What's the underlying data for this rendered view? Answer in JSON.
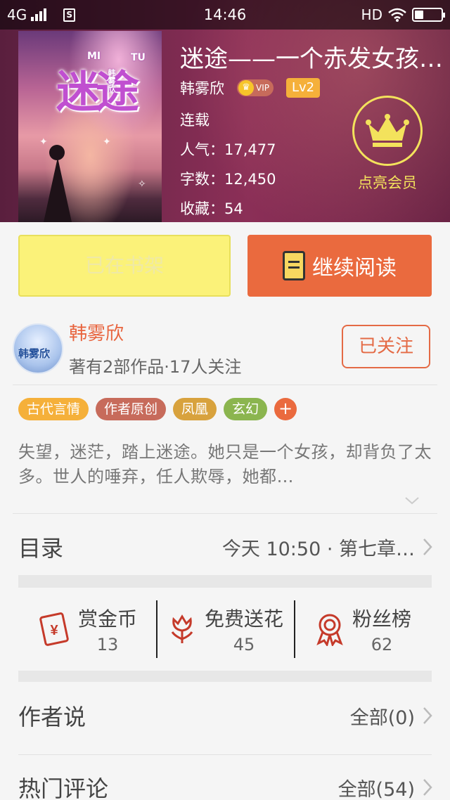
{
  "status_bar": {
    "network": "4G",
    "sim_label": "S",
    "time": "14:46",
    "hd": "HD"
  },
  "book": {
    "cover_title": "迷途",
    "cover_mi": "MI",
    "cover_tu": "TU",
    "cover_author": "韩雾欣",
    "title": "迷途——一个赤发女孩…",
    "author": "韩雾欣",
    "vip_label": "VIP",
    "level": "Lv2",
    "status": "连载",
    "popularity": "人气：17,477",
    "word_count": "字数：12,450",
    "favorites": "收藏：54",
    "member_label": "点亮会员"
  },
  "actions": {
    "shelf_label": "已在书架",
    "read_label": "继续阅读"
  },
  "author_card": {
    "avatar_text": "韩雾欣",
    "name": "韩雾欣",
    "summary": "著有2部作品·17人关注",
    "follow_label": "已关注"
  },
  "tags": [
    {
      "label": "古代言情",
      "color": "#f5b03a"
    },
    {
      "label": "作者原创",
      "color": "#c76b5b"
    },
    {
      "label": "凤凰",
      "color": "#d8a23d"
    },
    {
      "label": "玄幻",
      "color": "#8bb54f"
    }
  ],
  "synopsis": "失望，迷茫，踏上迷途。她只是一个女孩，却背负了太多。世人的唾弃，任人欺辱，她都…",
  "catalog": {
    "title": "目录",
    "info": "今天 10:50 · 第七章…"
  },
  "stats": [
    {
      "label": "赏金币",
      "value": "13",
      "icon": "reward-envelope-icon"
    },
    {
      "label": "免费送花",
      "value": "45",
      "icon": "flower-icon"
    },
    {
      "label": "粉丝榜",
      "value": "62",
      "icon": "medal-icon"
    }
  ],
  "author_says": {
    "title": "作者说",
    "info": "全部(0)"
  },
  "hot_comments": {
    "title": "热门评论",
    "info": "全部(54)"
  },
  "colors": {
    "accent": "#ea6a3e",
    "shelf_button": "#fbf279",
    "member_gold": "#f3e25c"
  }
}
